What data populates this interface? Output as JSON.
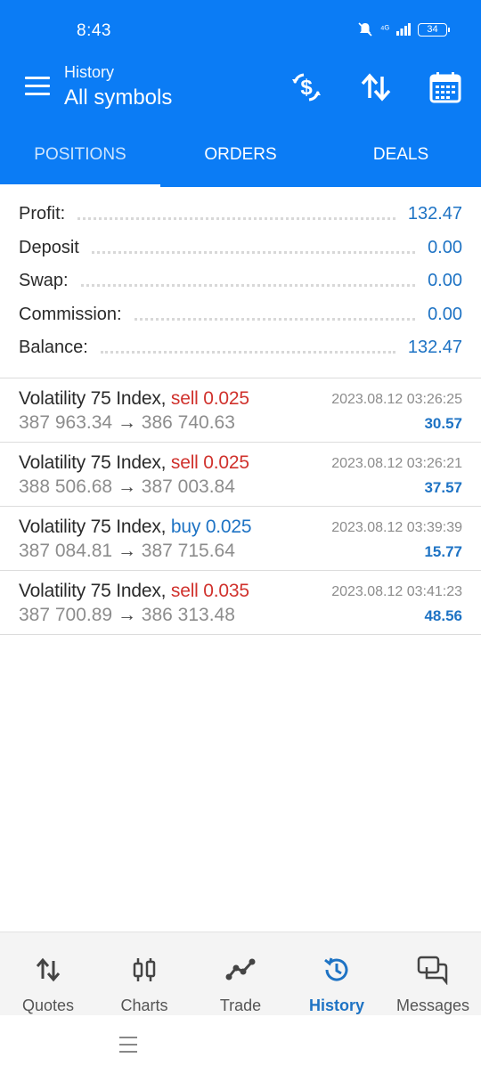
{
  "status_bar": {
    "time": "8:43",
    "signal": "⁴ᴳ",
    "battery": "34"
  },
  "appbar": {
    "subtitle": "History",
    "title": "All symbols",
    "actions": [
      "dollar-exchange-icon",
      "sort-icon",
      "calendar-icon"
    ]
  },
  "tabs": [
    {
      "label": "POSITIONS",
      "active": true
    },
    {
      "label": "ORDERS",
      "active": false
    },
    {
      "label": "DEALS",
      "active": false
    }
  ],
  "summary": {
    "profit_label": "Profit:",
    "profit_value": "132.47",
    "deposit_label": "Deposit",
    "deposit_value": "0.00",
    "swap_label": "Swap:",
    "swap_value": "0.00",
    "commission_label": "Commission:",
    "commission_value": "0.00",
    "balance_label": "Balance:",
    "balance_value": "132.47"
  },
  "deals": [
    {
      "symbol": "Volatility 75 Index,",
      "side": "sell 0.025",
      "open": "387 963.34",
      "arrow": "→",
      "close": "386 740.63",
      "time": "2023.08.12 03:26:25",
      "profit": "30.57"
    },
    {
      "symbol": "Volatility 75 Index,",
      "side": "sell 0.025",
      "open": "388 506.68",
      "arrow": "→",
      "close": "387 003.84",
      "time": "2023.08.12 03:26:21",
      "profit": "37.57"
    },
    {
      "symbol": "Volatility 75 Index,",
      "side": "buy 0.025",
      "open": "387 084.81",
      "arrow": "→",
      "close": "387 715.64",
      "time": "2023.08.12 03:39:39",
      "profit": "15.77"
    },
    {
      "symbol": "Volatility 75 Index,",
      "side": "sell 0.035",
      "open": "387 700.89",
      "arrow": "→",
      "close": "386 313.48",
      "time": "2023.08.12 03:41:23",
      "profit": "48.56"
    }
  ],
  "bottom_nav": [
    {
      "label": "Quotes",
      "icon": "quotes-icon"
    },
    {
      "label": "Charts",
      "icon": "charts-icon"
    },
    {
      "label": "Trade",
      "icon": "trade-icon"
    },
    {
      "label": "History",
      "icon": "history-icon",
      "active": true
    },
    {
      "label": "Messages",
      "icon": "messages-icon"
    }
  ],
  "colors": {
    "accent": "#0b7cf5",
    "profit_blue": "#1e73c4",
    "sell_red": "#d0322d"
  }
}
